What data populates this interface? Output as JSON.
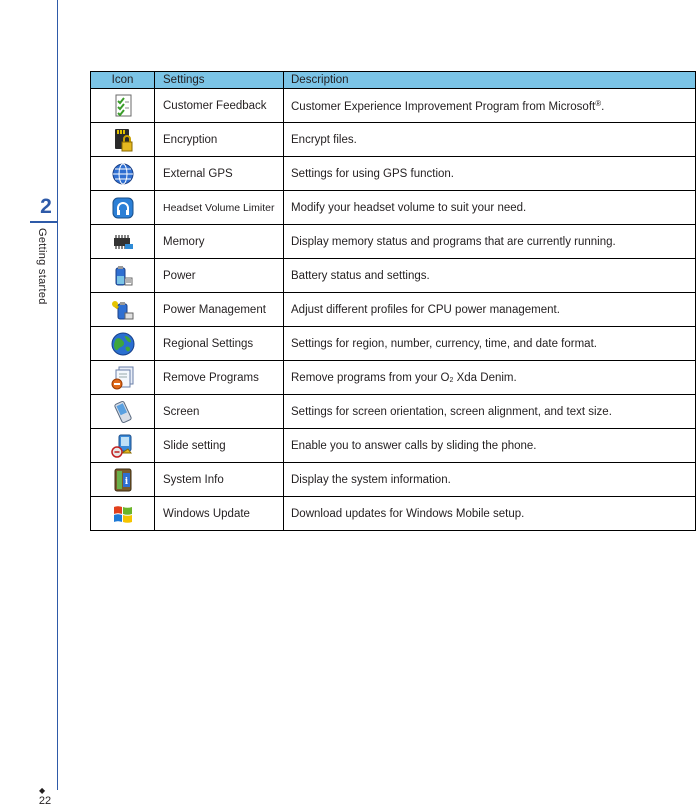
{
  "sidebar": {
    "chapter_number": "2",
    "chapter_title": "Getting started",
    "page_number": "22",
    "page_marker": "◆"
  },
  "table": {
    "headers": {
      "icon": "Icon",
      "settings": "Settings",
      "description": "Description"
    },
    "rows": [
      {
        "icon": "customer-feedback-icon",
        "setting": "Customer Feedback",
        "description": "Customer Experience Improvement Program from Microsoft",
        "description_suffix": "®",
        "description_end": "."
      },
      {
        "icon": "encryption-icon",
        "setting": "Encryption",
        "description": "Encrypt files."
      },
      {
        "icon": "external-gps-icon",
        "setting": "External GPS",
        "description": "Settings for using GPS function."
      },
      {
        "icon": "headset-volume-limiter-icon",
        "setting": "Headset Volume Limiter",
        "description": "Modify your headset volume to suit your need."
      },
      {
        "icon": "memory-icon",
        "setting": "Memory",
        "description": "Display memory status and programs that are currently running."
      },
      {
        "icon": "power-icon",
        "setting": "Power",
        "description": "Battery status and settings."
      },
      {
        "icon": "power-management-icon",
        "setting": "Power Management",
        "description": "Adjust different profiles for CPU power management."
      },
      {
        "icon": "regional-settings-icon",
        "setting": "Regional Settings",
        "description": "Settings for region, number, currency, time, and date format."
      },
      {
        "icon": "remove-programs-icon",
        "setting": "Remove Programs",
        "description": "Remove programs from your O",
        "description_sub": "2",
        "description_end": " Xda Denim."
      },
      {
        "icon": "screen-icon",
        "setting": "Screen",
        "description": "Settings for screen orientation, screen alignment, and text size."
      },
      {
        "icon": "slide-setting-icon",
        "setting": "Slide setting",
        "description": "Enable you to answer calls by sliding the phone."
      },
      {
        "icon": "system-info-icon",
        "setting": "System Info",
        "description": "Display the system information."
      },
      {
        "icon": "windows-update-icon",
        "setting": "Windows Update",
        "description": "Download updates for Windows Mobile setup."
      }
    ]
  }
}
